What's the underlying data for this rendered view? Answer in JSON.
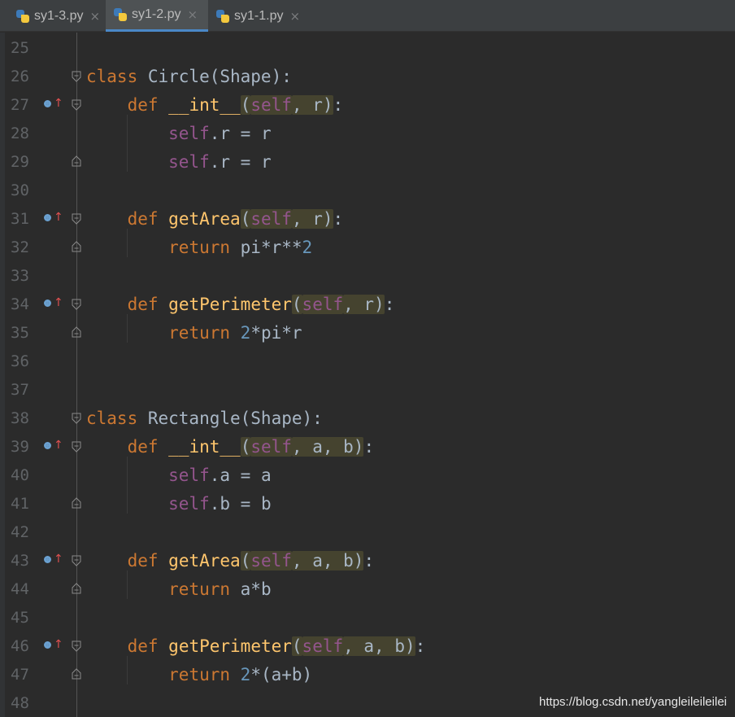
{
  "tabs": [
    {
      "label": "sy1-3.py",
      "active": false
    },
    {
      "label": "sy1-2.py",
      "active": true
    },
    {
      "label": "sy1-1.py",
      "active": false
    }
  ],
  "lines": [
    {
      "n": "25",
      "code": []
    },
    {
      "n": "26",
      "fold": "open",
      "code": [
        {
          "t": "class",
          "c": "kw"
        },
        {
          "t": " Circle(Shape):"
        }
      ]
    },
    {
      "n": "27",
      "mark": true,
      "fold": "open",
      "code": [
        {
          "t": "    "
        },
        {
          "t": "def",
          "c": "kw"
        },
        {
          "t": " "
        },
        {
          "t": "__int__",
          "c": "fn"
        },
        {
          "t": "(",
          "c": "hl"
        },
        {
          "t": "self",
          "c": "self hl"
        },
        {
          "t": ", r)",
          "c": "hl"
        },
        {
          "t": ":"
        }
      ]
    },
    {
      "n": "28",
      "code": [
        {
          "t": "        "
        },
        {
          "t": "self",
          "c": "self"
        },
        {
          "t": ".r = r"
        }
      ]
    },
    {
      "n": "29",
      "fold": "close",
      "code": [
        {
          "t": "        "
        },
        {
          "t": "self",
          "c": "self"
        },
        {
          "t": ".r = r"
        }
      ]
    },
    {
      "n": "30",
      "code": []
    },
    {
      "n": "31",
      "mark": true,
      "fold": "open",
      "code": [
        {
          "t": "    "
        },
        {
          "t": "def",
          "c": "kw"
        },
        {
          "t": " "
        },
        {
          "t": "getArea",
          "c": "fn"
        },
        {
          "t": "(",
          "c": "hl"
        },
        {
          "t": "self",
          "c": "self hl"
        },
        {
          "t": ", r)",
          "c": "hl"
        },
        {
          "t": ":"
        }
      ]
    },
    {
      "n": "32",
      "fold": "close",
      "code": [
        {
          "t": "        "
        },
        {
          "t": "return",
          "c": "kw"
        },
        {
          "t": " pi*r**"
        },
        {
          "t": "2",
          "c": "num"
        }
      ]
    },
    {
      "n": "33",
      "code": []
    },
    {
      "n": "34",
      "mark": true,
      "fold": "open",
      "code": [
        {
          "t": "    "
        },
        {
          "t": "def",
          "c": "kw"
        },
        {
          "t": " "
        },
        {
          "t": "getPerimeter",
          "c": "fn"
        },
        {
          "t": "(",
          "c": "hl"
        },
        {
          "t": "self",
          "c": "self hl"
        },
        {
          "t": ", r)",
          "c": "hl"
        },
        {
          "t": ":"
        }
      ]
    },
    {
      "n": "35",
      "fold": "close",
      "code": [
        {
          "t": "        "
        },
        {
          "t": "return",
          "c": "kw"
        },
        {
          "t": " "
        },
        {
          "t": "2",
          "c": "num"
        },
        {
          "t": "*pi*r"
        }
      ]
    },
    {
      "n": "36",
      "code": []
    },
    {
      "n": "37",
      "code": []
    },
    {
      "n": "38",
      "fold": "open",
      "code": [
        {
          "t": "class",
          "c": "kw"
        },
        {
          "t": " Rectangle(Shape):"
        }
      ]
    },
    {
      "n": "39",
      "mark": true,
      "fold": "open",
      "code": [
        {
          "t": "    "
        },
        {
          "t": "def",
          "c": "kw"
        },
        {
          "t": " "
        },
        {
          "t": "__int__",
          "c": "fn"
        },
        {
          "t": "(",
          "c": "hl"
        },
        {
          "t": "self",
          "c": "self hl"
        },
        {
          "t": ", a, b)",
          "c": "hl"
        },
        {
          "t": ":"
        }
      ]
    },
    {
      "n": "40",
      "code": [
        {
          "t": "        "
        },
        {
          "t": "self",
          "c": "self"
        },
        {
          "t": ".a = a"
        }
      ]
    },
    {
      "n": "41",
      "fold": "close",
      "code": [
        {
          "t": "        "
        },
        {
          "t": "self",
          "c": "self"
        },
        {
          "t": ".b = b"
        }
      ]
    },
    {
      "n": "42",
      "code": []
    },
    {
      "n": "43",
      "mark": true,
      "fold": "open",
      "code": [
        {
          "t": "    "
        },
        {
          "t": "def",
          "c": "kw"
        },
        {
          "t": " "
        },
        {
          "t": "getArea",
          "c": "fn"
        },
        {
          "t": "(",
          "c": "hl"
        },
        {
          "t": "self",
          "c": "self hl"
        },
        {
          "t": ", a, b)",
          "c": "hl"
        },
        {
          "t": ":"
        }
      ]
    },
    {
      "n": "44",
      "fold": "close",
      "code": [
        {
          "t": "        "
        },
        {
          "t": "return",
          "c": "kw"
        },
        {
          "t": " a*b"
        }
      ]
    },
    {
      "n": "45",
      "code": []
    },
    {
      "n": "46",
      "mark": true,
      "fold": "open",
      "code": [
        {
          "t": "    "
        },
        {
          "t": "def",
          "c": "kw"
        },
        {
          "t": " "
        },
        {
          "t": "getPerimeter",
          "c": "fn"
        },
        {
          "t": "(",
          "c": "hl"
        },
        {
          "t": "self",
          "c": "self hl"
        },
        {
          "t": ", a, b)",
          "c": "hl"
        },
        {
          "t": ":"
        }
      ]
    },
    {
      "n": "47",
      "fold": "close",
      "code": [
        {
          "t": "        "
        },
        {
          "t": "return",
          "c": "kw"
        },
        {
          "t": " "
        },
        {
          "t": "2",
          "c": "num"
        },
        {
          "t": "*(a+b)"
        }
      ]
    },
    {
      "n": "48",
      "code": []
    }
  ],
  "watermark": "https://blog.csdn.net/yangleileileilei",
  "colors": {
    "keyword": "#cc7832",
    "self": "#94558d",
    "function": "#ffc66d",
    "number": "#6897bb",
    "text": "#a9b7c6",
    "background": "#2b2b2b"
  },
  "icons": {
    "gutter_mark": "overrides-method-icon",
    "fold_open": "fold-open-icon",
    "fold_close": "fold-close-icon",
    "tab": "python-file-icon",
    "tab_close": "close-icon"
  }
}
